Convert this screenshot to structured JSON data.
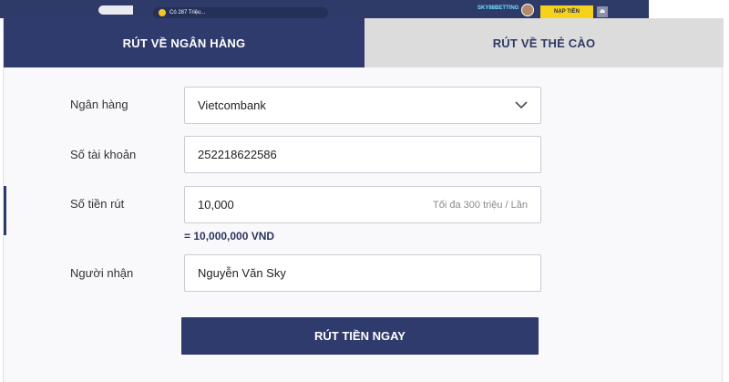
{
  "header": {
    "promo_text": "Có 287 Triệu...",
    "brand": "SKY88BETTING",
    "deposit_label": "NẠP TIỀN",
    "logout_glyph": "⏏"
  },
  "tabs": [
    {
      "label": "RÚT VỀ NGÂN HÀNG",
      "active": true
    },
    {
      "label": "RÚT VỀ THẺ CÀO",
      "active": false
    }
  ],
  "form": {
    "bank": {
      "label": "Ngân hàng",
      "value": "Vietcombank"
    },
    "account": {
      "label": "Số tài khoản",
      "value": "252218622586"
    },
    "amount": {
      "label": "Số tiền rút",
      "value": "10,000",
      "hint": "Tối đa 300 triệu / Lần"
    },
    "converted": "= 10,000,000 VND",
    "recipient": {
      "label": "Người nhận",
      "value": "Nguyễn Văn Sky"
    },
    "submit_label": "RÚT TIỀN NGAY"
  },
  "colors": {
    "primary": "#303b6d",
    "tab_inactive": "#dcdcdc",
    "accent_yellow": "#f7d21c"
  },
  "icons": {
    "dropdown": "chevron-down-icon"
  }
}
